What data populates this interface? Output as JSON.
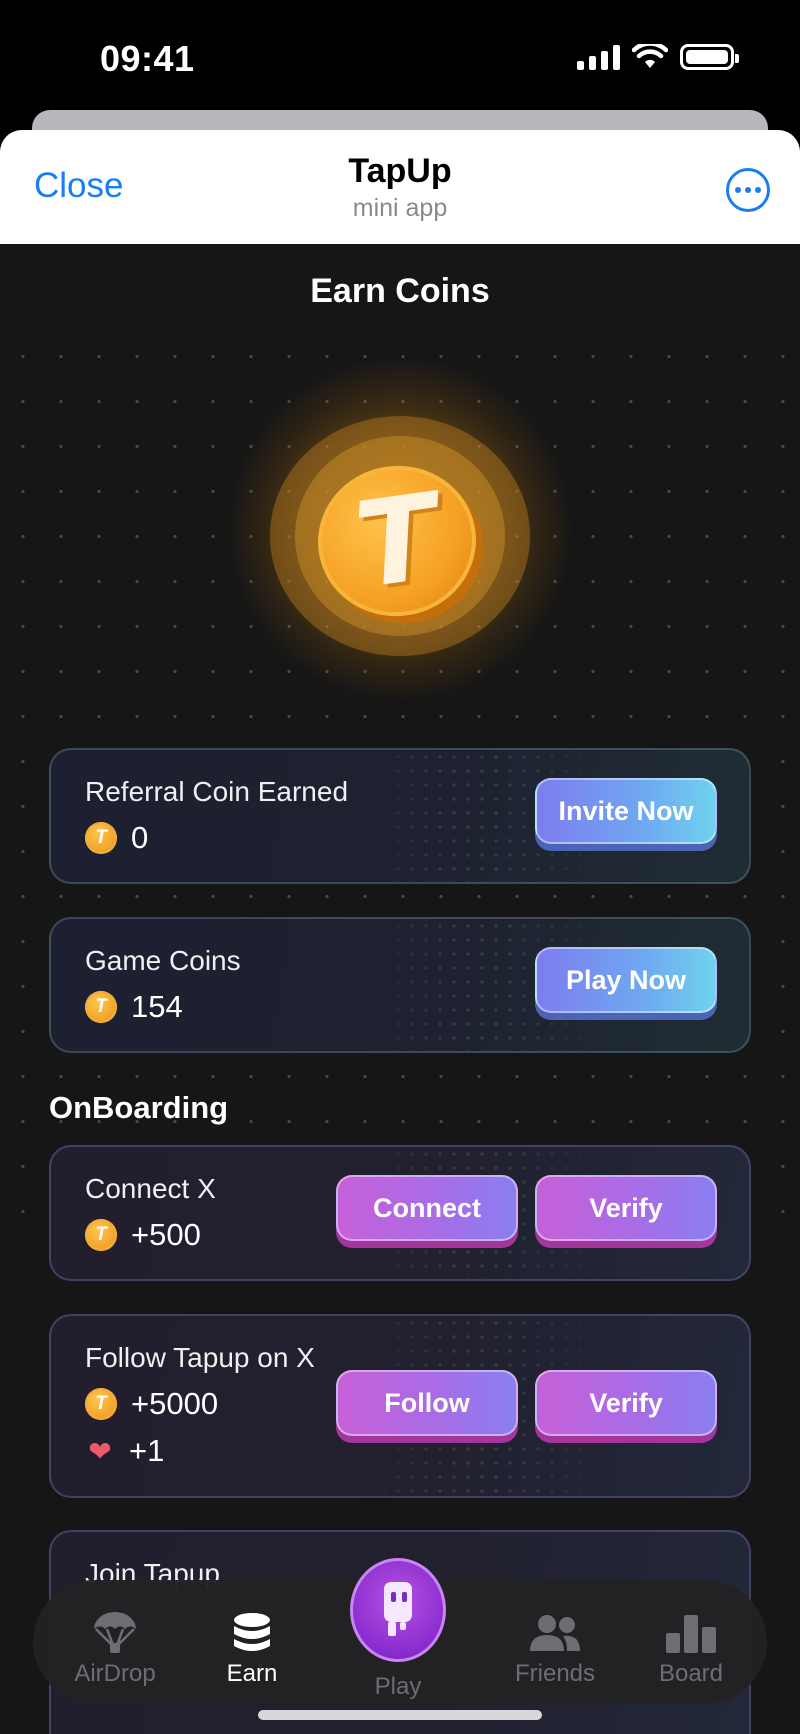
{
  "status_bar": {
    "time": "09:41"
  },
  "header": {
    "close_label": "Close",
    "title": "TapUp",
    "subtitle": "mini app",
    "more_icon": "ellipsis-circle-icon"
  },
  "page": {
    "title": "Earn Coins",
    "coin_letter": "T"
  },
  "cards": {
    "referral": {
      "label": "Referral Coin Earned",
      "value": "0",
      "button": "Invite Now"
    },
    "game": {
      "label": "Game Coins",
      "value": "154",
      "button": "Play Now"
    }
  },
  "onboarding": {
    "title": "OnBoarding",
    "connect_x": {
      "label": "Connect X",
      "reward": "+500",
      "button_primary": "Connect",
      "button_verify": "Verify"
    },
    "follow_x": {
      "label": "Follow Tapup on X",
      "reward": "+5000",
      "heart_reward": "+1",
      "button_primary": "Follow",
      "button_verify": "Verify"
    },
    "join": {
      "label": "Join Tapup"
    }
  },
  "tabs": [
    {
      "label": "AirDrop",
      "icon": "parachute-icon"
    },
    {
      "label": "Earn",
      "icon": "coin-stack-icon"
    },
    {
      "label": "Play",
      "icon": "robot-icon"
    },
    {
      "label": "Friends",
      "icon": "people-icon"
    },
    {
      "label": "Board",
      "icon": "bar-chart-icon"
    }
  ],
  "colors": {
    "accent_blue": "#1a7ef2",
    "coin_gold": "#f5a023",
    "play_purple": "#8a2dd0"
  }
}
